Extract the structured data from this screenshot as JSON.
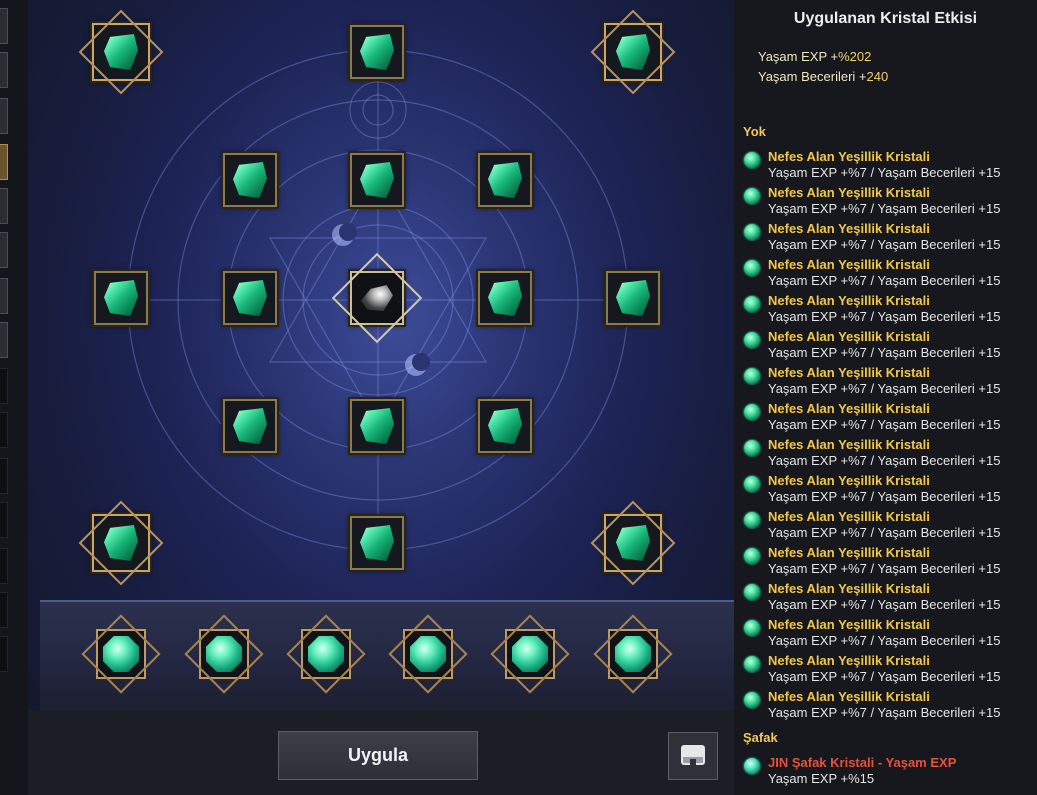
{
  "panel": {
    "title": "Uygulanan Kristal Etkisi",
    "stats": [
      {
        "label": "Yaşam EXP +",
        "value": "%202"
      },
      {
        "label": "Yaşam Becerileri +",
        "value": "240"
      }
    ],
    "groups": [
      {
        "title": "Yok",
        "entries": [
          {
            "name": "Nefes Alan Yeşillik Kristali",
            "desc": "Yaşam EXP +%7 / Yaşam Becerileri +15"
          },
          {
            "name": "Nefes Alan Yeşillik Kristali",
            "desc": "Yaşam EXP +%7 / Yaşam Becerileri +15"
          },
          {
            "name": "Nefes Alan Yeşillik Kristali",
            "desc": "Yaşam EXP +%7 / Yaşam Becerileri +15"
          },
          {
            "name": "Nefes Alan Yeşillik Kristali",
            "desc": "Yaşam EXP +%7 / Yaşam Becerileri +15"
          },
          {
            "name": "Nefes Alan Yeşillik Kristali",
            "desc": "Yaşam EXP +%7 / Yaşam Becerileri +15"
          },
          {
            "name": "Nefes Alan Yeşillik Kristali",
            "desc": "Yaşam EXP +%7 / Yaşam Becerileri +15"
          },
          {
            "name": "Nefes Alan Yeşillik Kristali",
            "desc": "Yaşam EXP +%7 / Yaşam Becerileri +15"
          },
          {
            "name": "Nefes Alan Yeşillik Kristali",
            "desc": "Yaşam EXP +%7 / Yaşam Becerileri +15"
          },
          {
            "name": "Nefes Alan Yeşillik Kristali",
            "desc": "Yaşam EXP +%7 / Yaşam Becerileri +15"
          },
          {
            "name": "Nefes Alan Yeşillik Kristali",
            "desc": "Yaşam EXP +%7 / Yaşam Becerileri +15"
          },
          {
            "name": "Nefes Alan Yeşillik Kristali",
            "desc": "Yaşam EXP +%7 / Yaşam Becerileri +15"
          },
          {
            "name": "Nefes Alan Yeşillik Kristali",
            "desc": "Yaşam EXP +%7 / Yaşam Becerileri +15"
          },
          {
            "name": "Nefes Alan Yeşillik Kristali",
            "desc": "Yaşam EXP +%7 / Yaşam Becerileri +15"
          },
          {
            "name": "Nefes Alan Yeşillik Kristali",
            "desc": "Yaşam EXP +%7 / Yaşam Becerileri +15"
          },
          {
            "name": "Nefes Alan Yeşillik Kristali",
            "desc": "Yaşam EXP +%7 / Yaşam Becerileri +15"
          },
          {
            "name": "Nefes Alan Yeşillik Kristali",
            "desc": "Yaşam EXP +%7 / Yaşam Becerileri +15"
          }
        ]
      },
      {
        "title": "Şafak",
        "entries": [
          {
            "name": "JIN Şafak Kristali - Yaşam EXP",
            "desc": "Yaşam EXP +%15"
          }
        ]
      }
    ]
  },
  "board": {
    "apply_label": "Uygula",
    "tray_icon": "tray-icon"
  }
}
